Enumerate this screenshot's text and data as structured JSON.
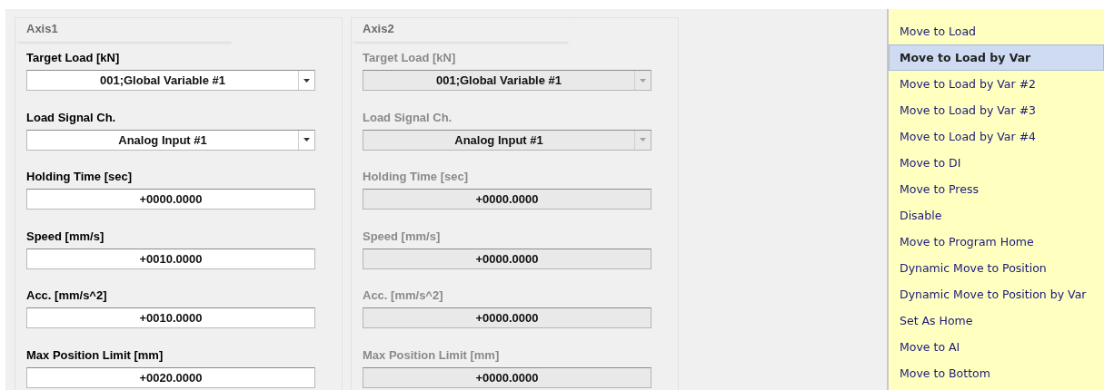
{
  "axes": [
    {
      "title": "Axis1",
      "disabled": false,
      "fields": [
        {
          "label": "Target Load [kN]",
          "kind": "dropdown",
          "value": "001;Global Variable #1"
        },
        {
          "label": "Load Signal Ch.",
          "kind": "dropdown",
          "value": "Analog Input #1"
        },
        {
          "label": "Holding Time [sec]",
          "kind": "text",
          "value": "+0000.0000"
        },
        {
          "label": "Speed [mm/s]",
          "kind": "text",
          "value": "+0010.0000"
        },
        {
          "label": "Acc. [mm/s^2]",
          "kind": "text",
          "value": "+0010.0000"
        },
        {
          "label": "Max Position Limit [mm]",
          "kind": "text",
          "value": "+0020.0000"
        }
      ]
    },
    {
      "title": "Axis2",
      "disabled": true,
      "fields": [
        {
          "label": "Target Load [kN]",
          "kind": "dropdown",
          "value": "001;Global Variable #1"
        },
        {
          "label": "Load Signal Ch.",
          "kind": "dropdown",
          "value": "Analog Input #1"
        },
        {
          "label": "Holding Time [sec]",
          "kind": "text",
          "value": "+0000.0000"
        },
        {
          "label": "Speed [mm/s]",
          "kind": "text",
          "value": "+0000.0000"
        },
        {
          "label": "Acc. [mm/s^2]",
          "kind": "text",
          "value": "+0000.0000"
        },
        {
          "label": "Max Position Limit [mm]",
          "kind": "text",
          "value": "+0000.0000"
        }
      ]
    }
  ],
  "command_list": [
    {
      "label": "Move to Load",
      "selected": false
    },
    {
      "label": "Move to Load by Var",
      "selected": true
    },
    {
      "label": "Move to Load by Var #2",
      "selected": false
    },
    {
      "label": "Move to Load by Var #3",
      "selected": false
    },
    {
      "label": "Move to Load by Var #4",
      "selected": false
    },
    {
      "label": "Move to DI",
      "selected": false
    },
    {
      "label": "Move to Press",
      "selected": false
    },
    {
      "label": "Disable",
      "selected": false
    },
    {
      "label": "Move to Program Home",
      "selected": false
    },
    {
      "label": "Dynamic Move to Position",
      "selected": false
    },
    {
      "label": "Dynamic Move to Position by Var",
      "selected": false
    },
    {
      "label": "Set As Home",
      "selected": false
    },
    {
      "label": "Move to AI",
      "selected": false
    },
    {
      "label": "Move to Bottom",
      "selected": false
    }
  ]
}
